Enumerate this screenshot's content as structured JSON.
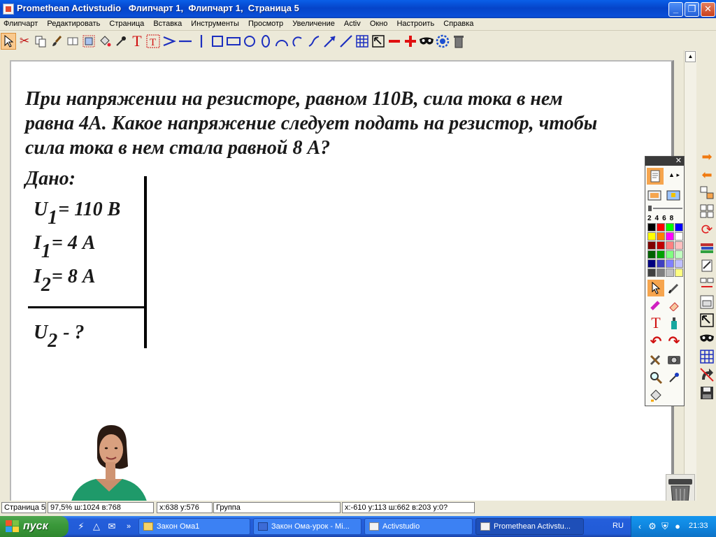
{
  "window": {
    "title": "Promethean Activstudio   Флипчарт 1,  Флипчарт 1,  Страница 5",
    "minimize_label": "_",
    "maximize_label": "❐",
    "close_label": "✕"
  },
  "menu": {
    "items": [
      "Флипчарт",
      "Редактировать",
      "Страница",
      "Вставка",
      "Инструменты",
      "Просмотр",
      "Увеличение",
      "Activ",
      "Окно",
      "Настроить",
      "Справка"
    ]
  },
  "toolbar": {
    "icons": [
      "pointer-icon",
      "scissors-icon",
      "copy-icon",
      "brush-icon",
      "book-icon",
      "duplicate-icon",
      "paint-bucket-icon",
      "eyedropper-icon",
      "text-icon",
      "text-edit-icon",
      "connector-icon",
      "line-icon",
      "vertical-line-icon",
      "square-icon",
      "rectangle-icon",
      "circle-icon",
      "ellipse-icon",
      "arc-icon",
      "small-arc-icon",
      "curve-icon",
      "arrow-icon",
      "diagonal-line-icon",
      "grid-icon",
      "resize-icon",
      "minus-icon",
      "plus-icon",
      "mask-icon",
      "revealer-icon",
      "trash-icon"
    ]
  },
  "page": {
    "question": "При напряжении на резисторе, равном 110В, сила тока в нем равна 4А. Какое напряжение следует подать на резистор, чтобы сила тока в нем стала равной 8 А?",
    "given_label": "Дано:",
    "u1_var": "U",
    "u1_sub": "1",
    "u1_val": "= 110 В",
    "i1_var": "I",
    "i1_sub": "1",
    "i1_val": "= 4 А",
    "i2_var": "I",
    "i2_sub": "2",
    "i2_val": "= 8 А",
    "u2_var": "U",
    "u2_sub": "2",
    "u2_val": " - ?"
  },
  "palette": {
    "close_label": "✕",
    "sizes": "2468",
    "colors": [
      [
        "#000000",
        "#ff0000",
        "#00ff00",
        "#0000ff"
      ],
      [
        "#ffff00",
        "#ff8000",
        "#ff00ff",
        "#ffffff"
      ],
      [
        "#800000",
        "#c00000",
        "#ff8080",
        "#ffc0c0"
      ],
      [
        "#006000",
        "#00a000",
        "#80ff80",
        "#c0ffc0"
      ],
      [
        "#000080",
        "#4040c0",
        "#8080ff",
        "#c0c0ff"
      ],
      [
        "#404040",
        "#808080",
        "#c0c0c0",
        "#ffff80"
      ]
    ]
  },
  "status": {
    "page": "Страница 5",
    "zoom": "97,5%  ш:1024  в:768",
    "cursor": "x:638  y:576",
    "group": "Группа",
    "selection": "x:-610  y:113  ш:662  в:203  у:0?"
  },
  "taskbar": {
    "start_label": "пуск",
    "tasks": [
      "Закон Ома1",
      "Закон Ома-урок - Mi...",
      "Activstudio",
      "Promethean Activstu..."
    ],
    "lang": "RU",
    "clock": "21:33",
    "more_label": "»"
  }
}
